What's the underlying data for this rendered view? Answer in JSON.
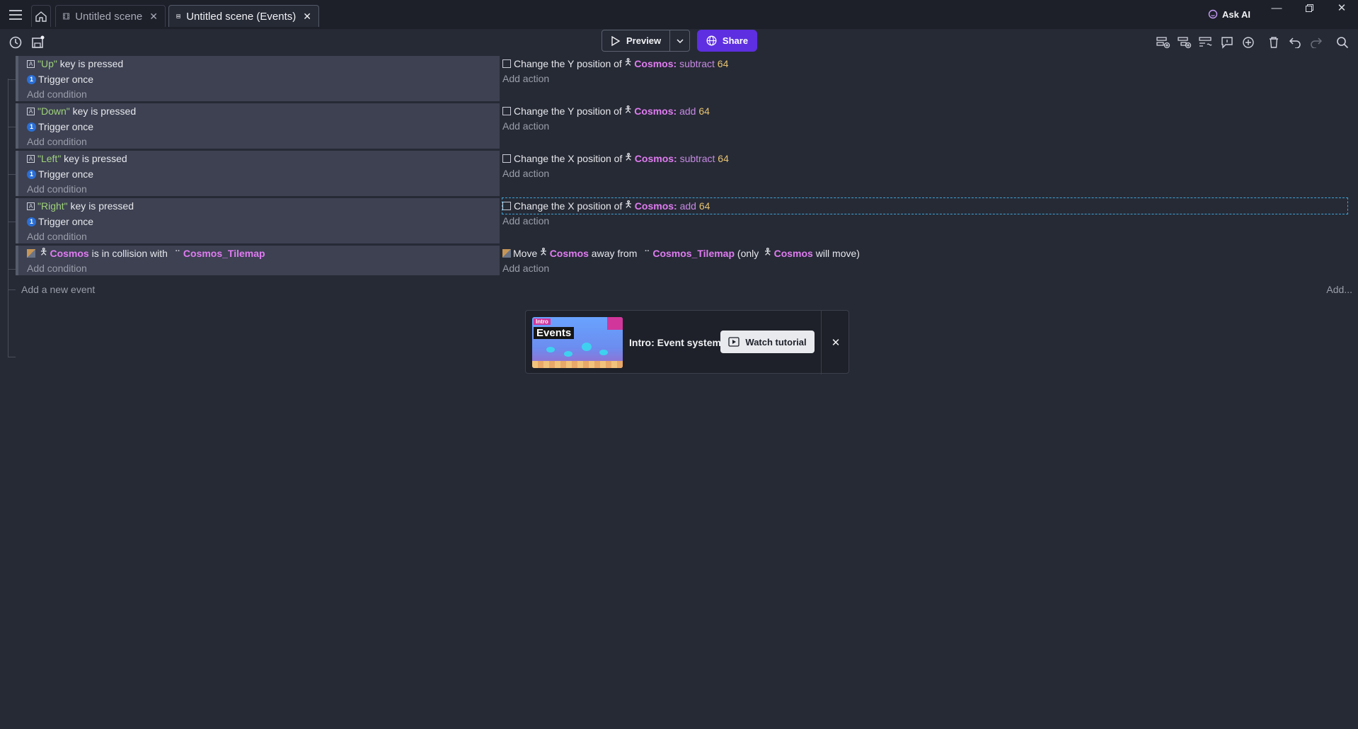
{
  "tabs": [
    {
      "label": "Untitled scene",
      "icon": "film-icon",
      "active": false
    },
    {
      "label": "Untitled scene (Events)",
      "icon": "events-icon",
      "active": true
    }
  ],
  "askai": {
    "label": "Ask AI"
  },
  "toolbar": {
    "preview_label": "Preview",
    "share_label": "Share"
  },
  "events": [
    {
      "conditions": [
        {
          "key": "\"Up\"",
          "text": " key is pressed"
        },
        {
          "trigger": "Trigger once"
        }
      ],
      "add_condition": "Add condition",
      "action": {
        "prefix": "Change the Y position of",
        "object": "Cosmos:",
        "op": "subtract",
        "value": "64"
      },
      "add_action": "Add action"
    },
    {
      "conditions": [
        {
          "key": "\"Down\"",
          "text": " key is pressed"
        },
        {
          "trigger": "Trigger once"
        }
      ],
      "add_condition": "Add condition",
      "action": {
        "prefix": "Change the Y position of",
        "object": "Cosmos:",
        "op": "add",
        "value": "64"
      },
      "add_action": "Add action"
    },
    {
      "conditions": [
        {
          "key": "\"Left\"",
          "text": " key is pressed"
        },
        {
          "trigger": "Trigger once"
        }
      ],
      "add_condition": "Add condition",
      "action": {
        "prefix": "Change the X position of",
        "object": "Cosmos:",
        "op": "subtract",
        "value": "64"
      },
      "add_action": "Add action"
    },
    {
      "conditions": [
        {
          "key": "\"Right\"",
          "text": " key is pressed"
        },
        {
          "trigger": "Trigger once"
        }
      ],
      "add_condition": "Add condition",
      "action": {
        "prefix": "Change the X position of",
        "object": "Cosmos:",
        "op": "add",
        "value": "64"
      },
      "add_action": "Add action"
    }
  ],
  "collision_event": {
    "object": "Cosmos",
    "middle": " is in collision with ",
    "target": "Cosmos_Tilemap",
    "add_condition": "Add condition",
    "action": {
      "move": "Move",
      "object": "Cosmos",
      "away": " away from ",
      "target": "Cosmos_Tilemap",
      "only": " (only ",
      "object2": "Cosmos",
      "tail": " will move)"
    },
    "add_action": "Add action"
  },
  "add_event": "Add a new event",
  "add_right": "Add...",
  "tutorial": {
    "thumb_intro": "Intro",
    "thumb_events": "Events",
    "title": "Intro: Event system",
    "watch_label": "Watch tutorial"
  }
}
